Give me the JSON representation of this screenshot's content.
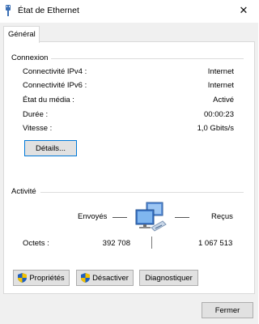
{
  "window": {
    "title": "État de Ethernet",
    "close_glyph": "✕"
  },
  "tabs": [
    {
      "label": "Général"
    }
  ],
  "connexion": {
    "title": "Connexion",
    "rows": [
      {
        "label": "Connectivité IPv4 :",
        "value": "Internet"
      },
      {
        "label": "Connectivité IPv6 :",
        "value": "Internet"
      },
      {
        "label": "État du média :",
        "value": "Activé"
      },
      {
        "label": "Durée :",
        "value": "00:00:23"
      },
      {
        "label": "Vitesse :",
        "value": "1,0 Gbits/s"
      }
    ],
    "details_button": "Détails..."
  },
  "activite": {
    "title": "Activité",
    "sent_label": "Envoyés",
    "received_label": "Reçus",
    "bytes_label": "Octets :",
    "sent_value": "392 708",
    "received_value": "1 067 513"
  },
  "buttons": {
    "properties": "Propriétés",
    "disable": "Désactiver",
    "diagnose": "Diagnostiquer",
    "close": "Fermer"
  },
  "icons": {
    "title": "ethernet-plug-icon",
    "shield": "uac-shield-icon",
    "network": "network-computers-icon"
  },
  "colors": {
    "shield_blue": "#1f5fbf",
    "shield_yellow": "#f2c200",
    "default_border": "#0078d7"
  }
}
